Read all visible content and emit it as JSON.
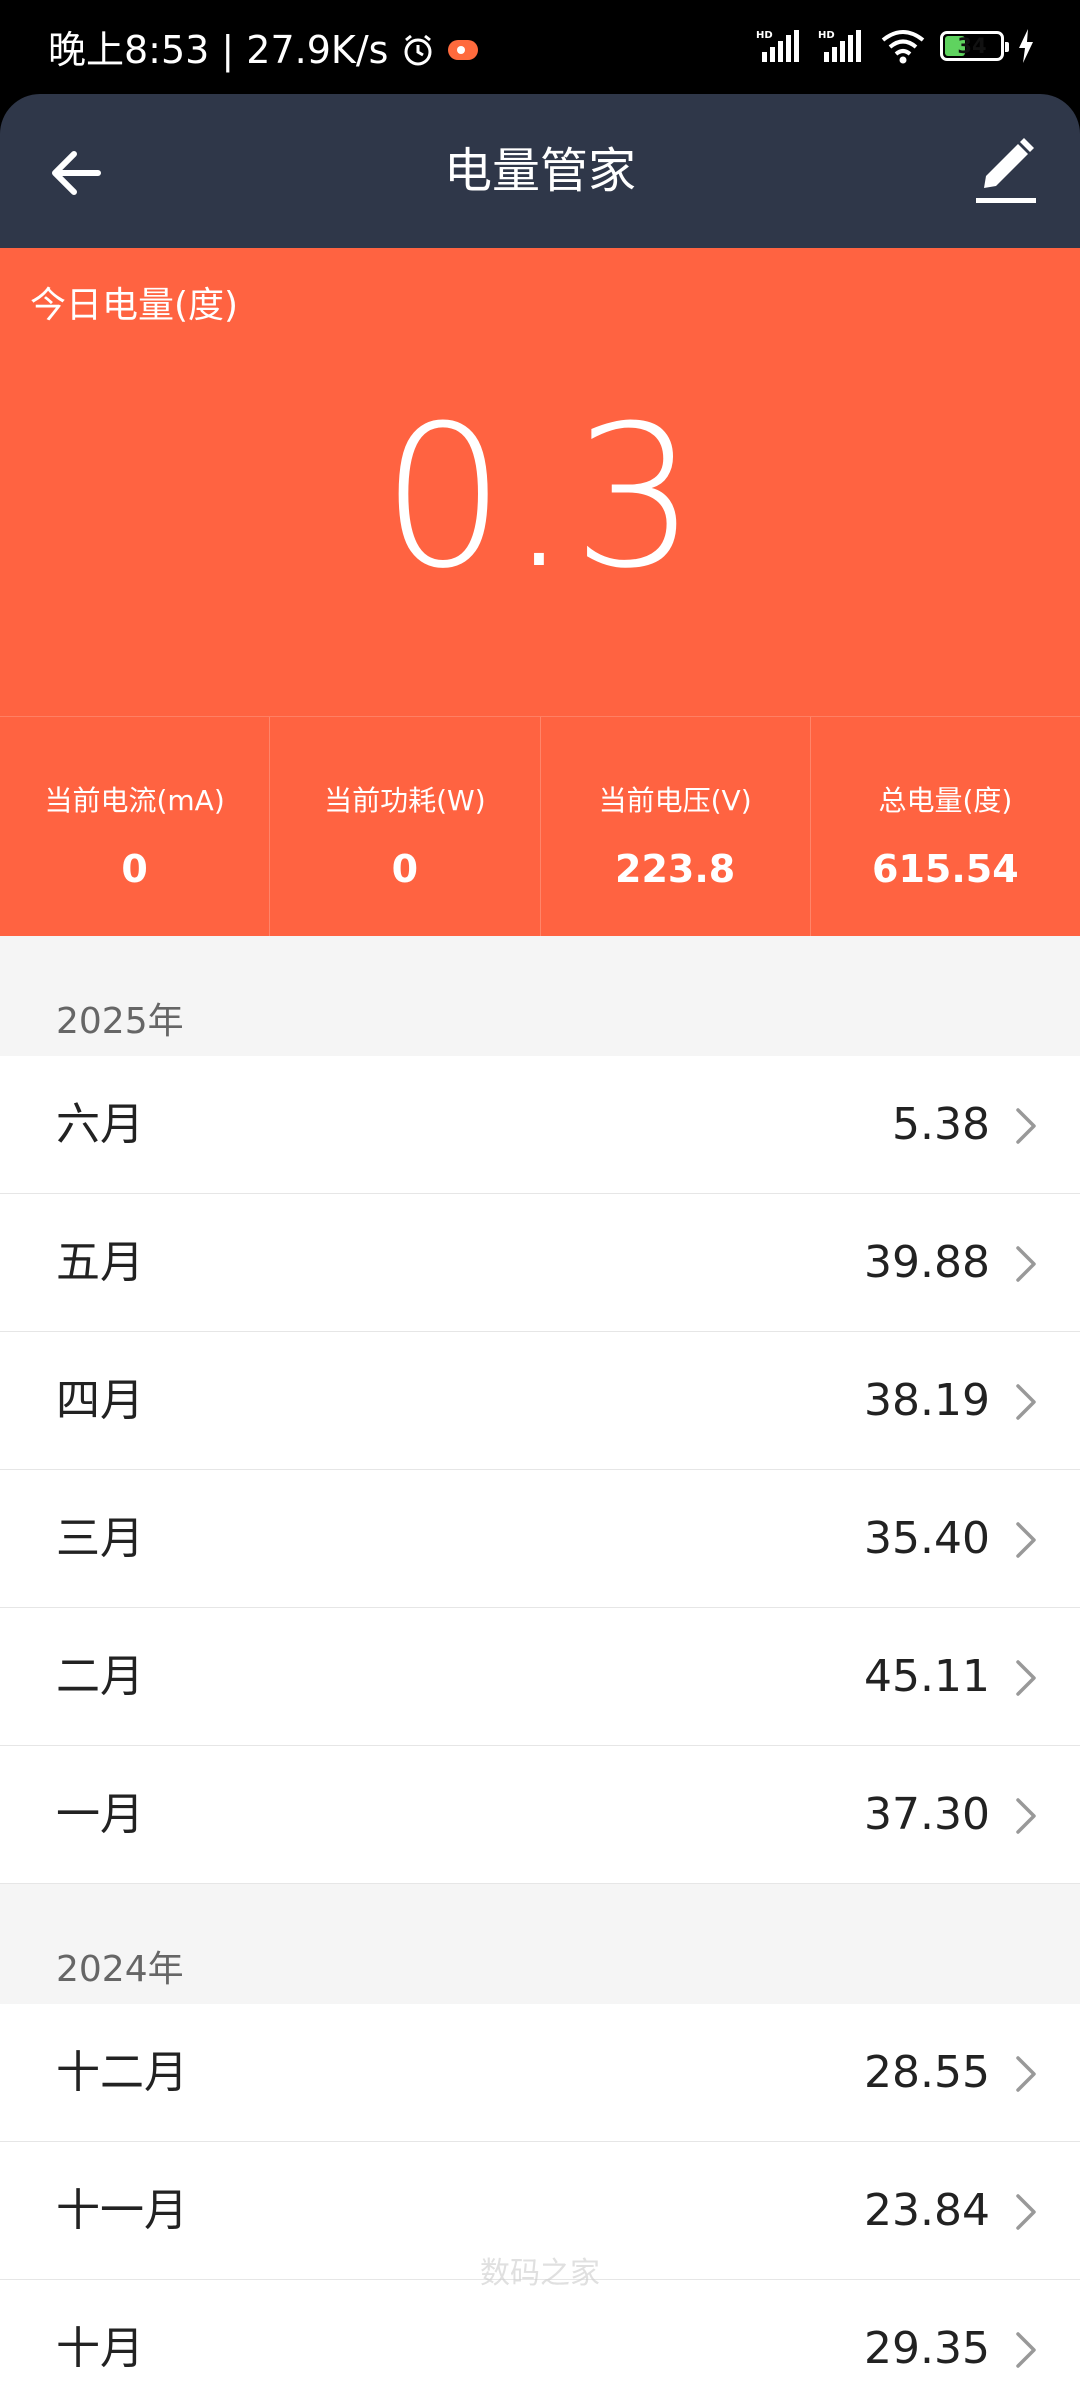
{
  "status_bar": {
    "time_text": "晚上8:53 | 27.9K/s",
    "battery_level": "34",
    "icons": [
      "alarm-icon",
      "notification-icon",
      "hd-signal-icon",
      "hd-signal-icon",
      "wifi-icon",
      "battery-icon",
      "charging-icon"
    ]
  },
  "header": {
    "title": "电量管家",
    "back_icon": "arrow-left-icon",
    "edit_icon": "pencil-icon"
  },
  "today": {
    "label": "今日电量(度)",
    "value": "0.3"
  },
  "stats": [
    {
      "label": "当前电流(mA)",
      "value": "0"
    },
    {
      "label": "当前功耗(W)",
      "value": "0"
    },
    {
      "label": "当前电压(V)",
      "value": "223.8"
    },
    {
      "label": "总电量(度)",
      "value": "615.54"
    }
  ],
  "years": [
    {
      "year": "2025年",
      "months": [
        {
          "label": "六月",
          "value": "5.38"
        },
        {
          "label": "五月",
          "value": "39.88"
        },
        {
          "label": "四月",
          "value": "38.19"
        },
        {
          "label": "三月",
          "value": "35.40"
        },
        {
          "label": "二月",
          "value": "45.11"
        },
        {
          "label": "一月",
          "value": "37.30"
        }
      ]
    },
    {
      "year": "2024年",
      "months": [
        {
          "label": "十二月",
          "value": "28.55"
        },
        {
          "label": "十一月",
          "value": "23.84"
        },
        {
          "label": "十月",
          "value": "29.35"
        }
      ]
    }
  ],
  "watermark": "数码之家",
  "colors": {
    "header_bg": "#2f3749",
    "accent": "#ff6341",
    "list_bg": "#f5f5f5"
  }
}
